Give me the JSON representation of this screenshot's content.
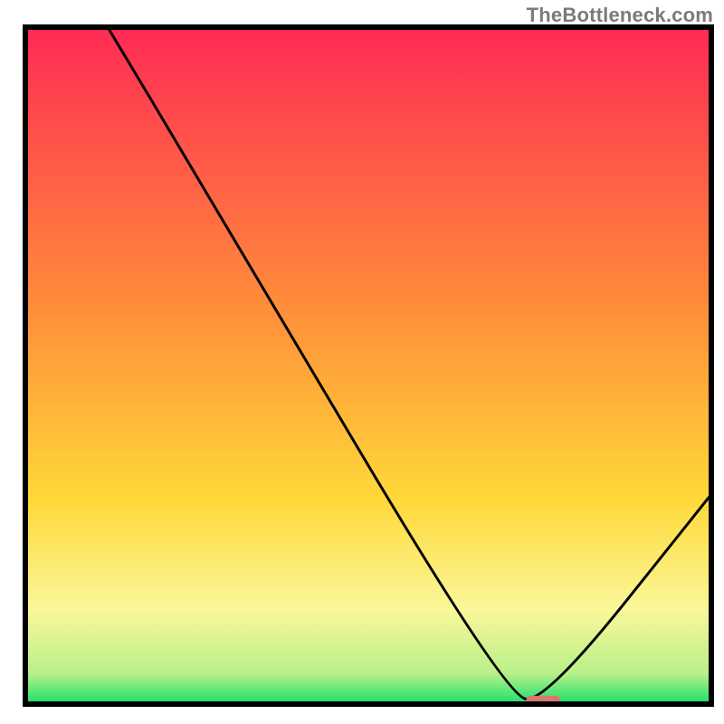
{
  "watermark": "TheBottleneck.com",
  "chart_data": {
    "type": "line",
    "title": "",
    "xlabel": "",
    "ylabel": "",
    "xlim": [
      0,
      100
    ],
    "ylim": [
      0,
      100
    ],
    "grid": false,
    "legend": false,
    "note": "Bottleneck curve overlaid on a vertical red→yellow→green gradient. The red marker on the baseline marks the optimum (minimum bottleneck).",
    "curve": {
      "name": "bottleneck",
      "x": [
        12,
        25,
        70,
        76,
        100
      ],
      "y": [
        100,
        78,
        1,
        0.5,
        31
      ]
    },
    "optimum_marker": {
      "x_start": 73,
      "x_end": 78,
      "y": 0.5
    },
    "gradient_stops": [
      {
        "offset": 0.0,
        "color": "#ff2a55"
      },
      {
        "offset": 0.4,
        "color": "#ff8a3a"
      },
      {
        "offset": 0.7,
        "color": "#ffd93a"
      },
      {
        "offset": 0.86,
        "color": "#faf79a"
      },
      {
        "offset": 0.955,
        "color": "#b9f08a"
      },
      {
        "offset": 1.0,
        "color": "#18e06a"
      }
    ],
    "frame_color": "#000000",
    "curve_color": "#000000",
    "marker_color": "#d9776f"
  }
}
